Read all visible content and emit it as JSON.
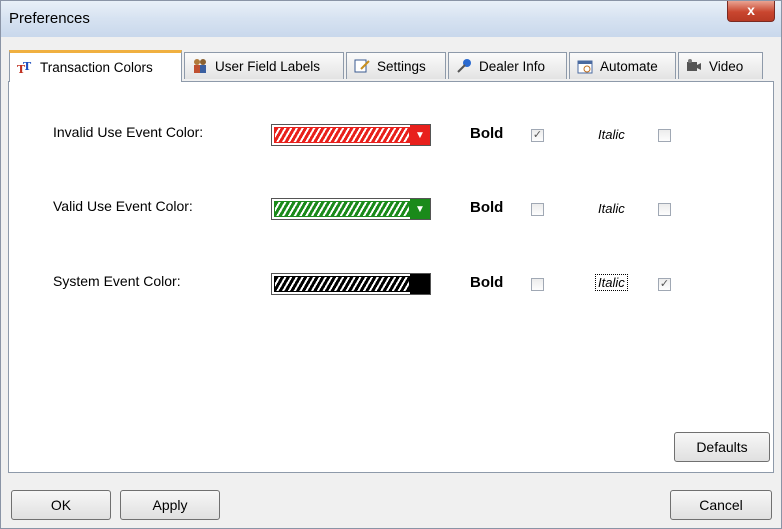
{
  "window": {
    "title": "Preferences",
    "close_glyph": "x"
  },
  "tabs": [
    {
      "label": "Transaction Colors",
      "icon": "TT",
      "active": true
    },
    {
      "label": "User Field Labels",
      "icon": "users-icon",
      "active": false
    },
    {
      "label": "Settings",
      "icon": "settings-icon",
      "active": false
    },
    {
      "label": "Dealer Info",
      "icon": "pin-icon",
      "active": false
    },
    {
      "label": "Automate",
      "icon": "automate-icon",
      "active": false
    },
    {
      "label": "Video",
      "icon": "video-icon",
      "active": false
    }
  ],
  "rows": [
    {
      "label": "Invalid Use Event Color:",
      "color": "#e8201c",
      "bold_label": "Bold",
      "bold": true,
      "italic_label": "Italic",
      "italic": false
    },
    {
      "label": "Valid Use Event Color:",
      "color": "#1a8a1a",
      "bold_label": "Bold",
      "bold": false,
      "italic_label": "Italic",
      "italic": false
    },
    {
      "label": "System Event Color:",
      "color": "#000000",
      "bold_label": "Bold",
      "bold": false,
      "italic_label": "Italic",
      "italic": true
    }
  ],
  "buttons": {
    "defaults": "Defaults",
    "ok": "OK",
    "apply": "Apply",
    "cancel": "Cancel"
  }
}
